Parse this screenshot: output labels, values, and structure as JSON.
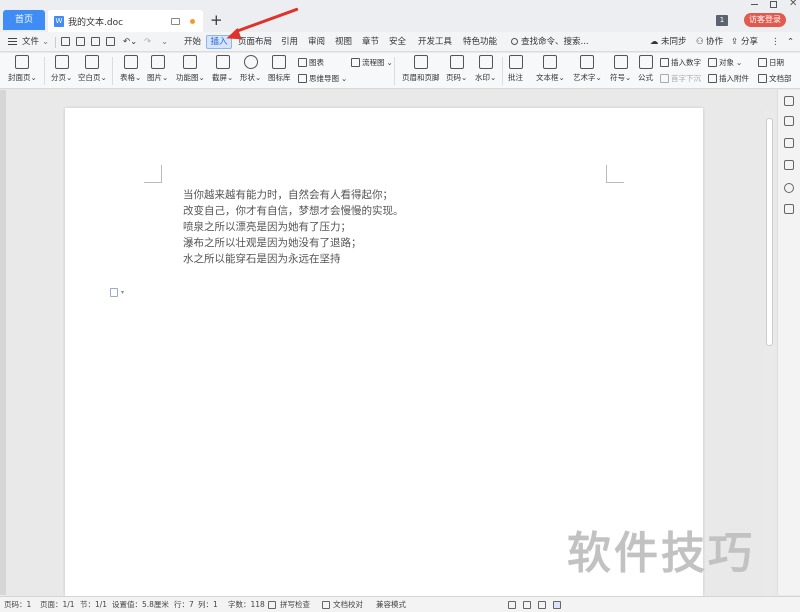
{
  "titlebar": {
    "home_tab": "首页",
    "doc_tab": "我的文本.doc",
    "badge_count": "1",
    "visitor_login": "访客登录"
  },
  "menubar": {
    "file": "文件",
    "tabs": [
      "开始",
      "插入",
      "页面布局",
      "引用",
      "审阅",
      "视图",
      "章节",
      "安全",
      "开发工具",
      "特色功能"
    ],
    "active_tab": "插入",
    "search": "查找命令、搜索...",
    "sync": "未同步",
    "collab": "协作",
    "share": "分享"
  },
  "ribbon": {
    "cover": "封面页",
    "page_break": "分页",
    "blank_page": "空白页",
    "table": "表格",
    "picture": "图片",
    "feature_chart": "功能图",
    "screenshot": "截屏",
    "shape": "形状",
    "icon_lib": "图标库",
    "chart": "图表",
    "mind_map": "思维导图",
    "flowchart": "流程图",
    "header_footer": "页眉和页脚",
    "page_number": "页码",
    "watermark": "水印",
    "comment": "批注",
    "textbox": "文本框",
    "art_text": "艺术字",
    "symbol": "符号",
    "formula": "公式",
    "insert_number": "插入数字",
    "drop_cap": "首字下沉",
    "object": "对象",
    "attachment": "插入附件",
    "date": "日期",
    "doc_parts": "文档部"
  },
  "document": {
    "lines": [
      "当你越来越有能力时，自然会有人看得起你；",
      "改变自己，你才有自信，梦想才会慢慢的实现。",
      "喷泉之所以漂亮是因为她有了压力；",
      "瀑布之所以壮观是因为她没有了退路；",
      "水之所以能穿石是因为永远在坚持"
    ]
  },
  "watermark_text": "软件技巧",
  "statusbar": {
    "page_no": "页码：1",
    "pages": "页面：1/1",
    "section": "节：1/1",
    "setting": "设置值：5.8厘米",
    "row": "行：7",
    "col": "列：1",
    "word_count": "字数：118",
    "spell_check": "拼写检查",
    "doc_proof": "文档校对",
    "compat_mode": "兼容模式"
  },
  "colors": {
    "accent": "#3f8cf5",
    "visitor": "#e05a4e",
    "arrow": "#e0322c"
  }
}
